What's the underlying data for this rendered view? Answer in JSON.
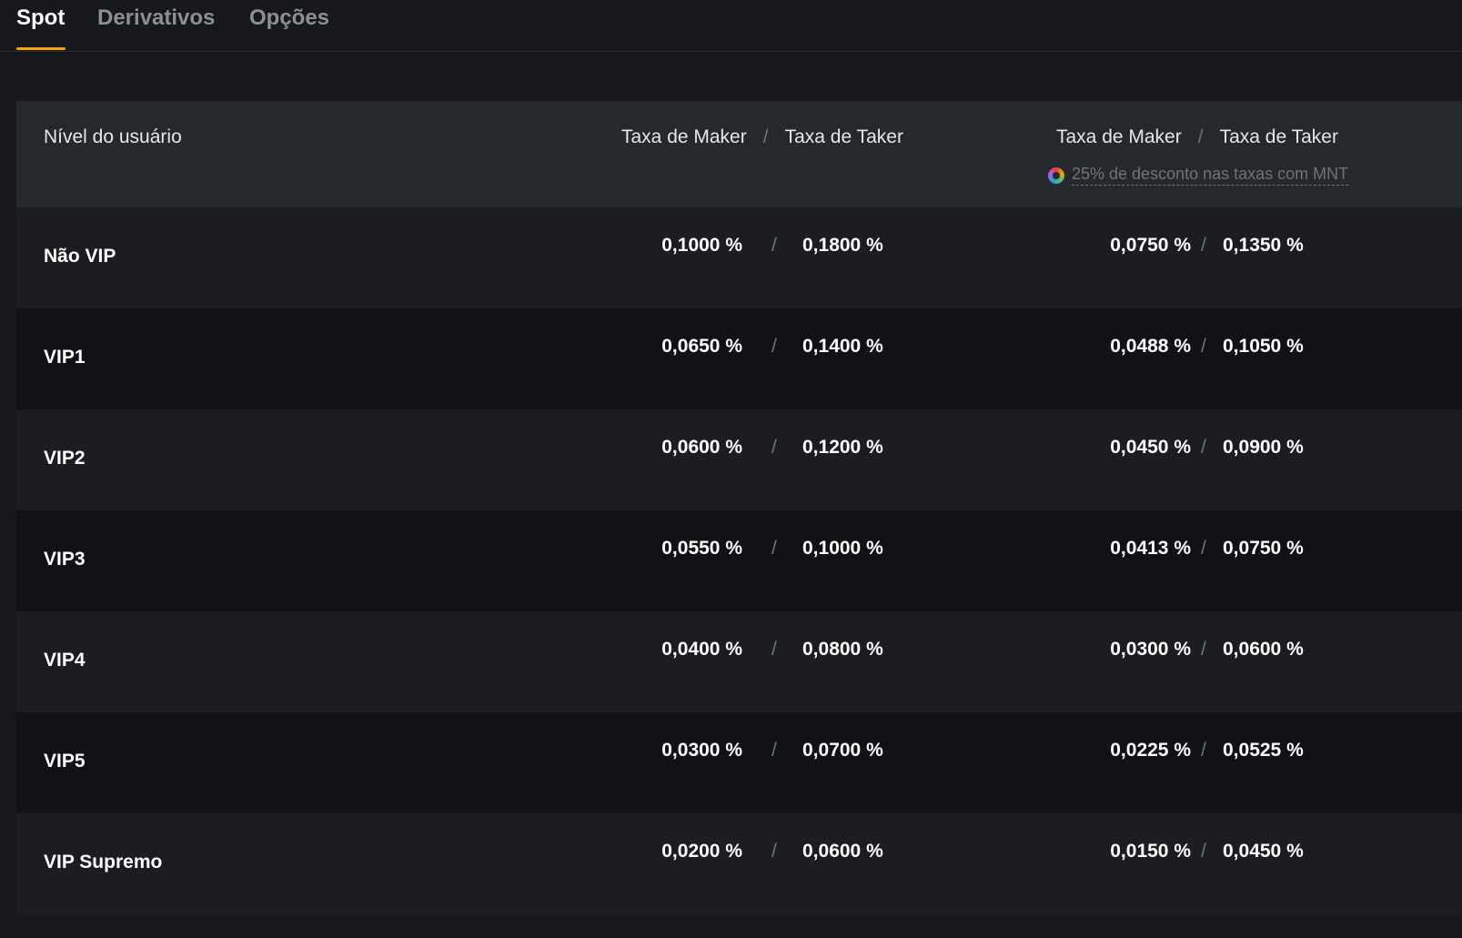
{
  "tabs": [
    {
      "label": "Spot",
      "active": true
    },
    {
      "label": "Derivativos",
      "active": false
    },
    {
      "label": "Opções",
      "active": false
    }
  ],
  "header": {
    "level": "Nível do usuário",
    "group1": {
      "maker": "Taxa de Maker",
      "sep": "/",
      "taker": "Taxa de Taker"
    },
    "group2": {
      "maker": "Taxa de Maker",
      "sep": "/",
      "taker": "Taxa de Taker"
    },
    "note": "25% de desconto nas taxas com MNT",
    "note_icon": "mnt-token-icon"
  },
  "rows": [
    {
      "level": "Não VIP",
      "maker": "0,1000 %",
      "taker": "0,1800 %",
      "maker_mnt": "0,0750 %",
      "taker_mnt": "0,1350 %"
    },
    {
      "level": "VIP1",
      "maker": "0,0650 %",
      "taker": "0,1400 %",
      "maker_mnt": "0,0488 %",
      "taker_mnt": "0,1050 %"
    },
    {
      "level": "VIP2",
      "maker": "0,0600 %",
      "taker": "0,1200 %",
      "maker_mnt": "0,0450 %",
      "taker_mnt": "0,0900 %"
    },
    {
      "level": "VIP3",
      "maker": "0,0550 %",
      "taker": "0,1000 %",
      "maker_mnt": "0,0413 %",
      "taker_mnt": "0,0750 %"
    },
    {
      "level": "VIP4",
      "maker": "0,0400 %",
      "taker": "0,0800 %",
      "maker_mnt": "0,0300 %",
      "taker_mnt": "0,0600 %"
    },
    {
      "level": "VIP5",
      "maker": "0,0300 %",
      "taker": "0,0700 %",
      "maker_mnt": "0,0225 %",
      "taker_mnt": "0,0525 %"
    },
    {
      "level": "VIP Supremo",
      "maker": "0,0200 %",
      "taker": "0,0600 %",
      "maker_mnt": "0,0150 %",
      "taker_mnt": "0,0450 %"
    }
  ],
  "separator": "/",
  "colors": {
    "accent": "#f7a600",
    "background": "#16181c",
    "header_bg": "#25282d"
  }
}
